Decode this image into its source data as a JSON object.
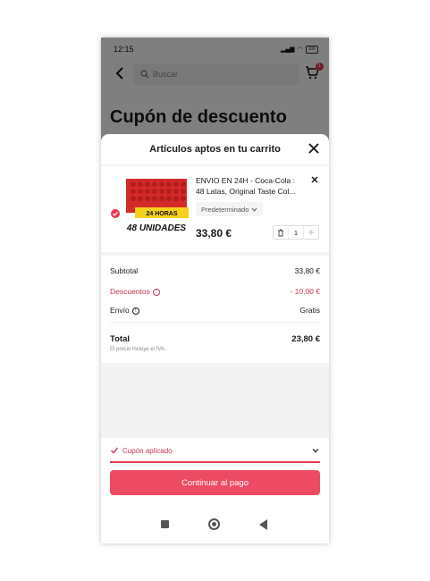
{
  "status_bar": {
    "time": "12:15",
    "battery": "100"
  },
  "search": {
    "placeholder": "Buscar"
  },
  "cart": {
    "badge": "1"
  },
  "page": {
    "title": "Cupón de descuento"
  },
  "sheet": {
    "title": "Artículos aptos en tu carrito",
    "item": {
      "name": "ENVIO EN 24H - Coca-Cola : 48 Latas, Original Taste Col...",
      "variant": "Predeterminado",
      "price": "33,80 €",
      "quantity": "1",
      "image_text": {
        "line1": "24 HORAS",
        "line2": "48 UNIDADES"
      }
    },
    "summary": {
      "subtotal_label": "Subtotal",
      "subtotal_value": "33,80 €",
      "discount_label": "Descuentos",
      "discount_value": "- 10,00 €",
      "shipping_label": "Envío",
      "shipping_value": "Gratis",
      "total_label": "Total",
      "total_value": "23,80 €",
      "tax_note": "El precio incluye el IVA."
    },
    "coupon_label": "Cupón aplicado",
    "pay_button": "Continuar al pago"
  },
  "colors": {
    "accent": "#e53955",
    "button": "#ed4b63",
    "discount_text": "#c93452"
  }
}
